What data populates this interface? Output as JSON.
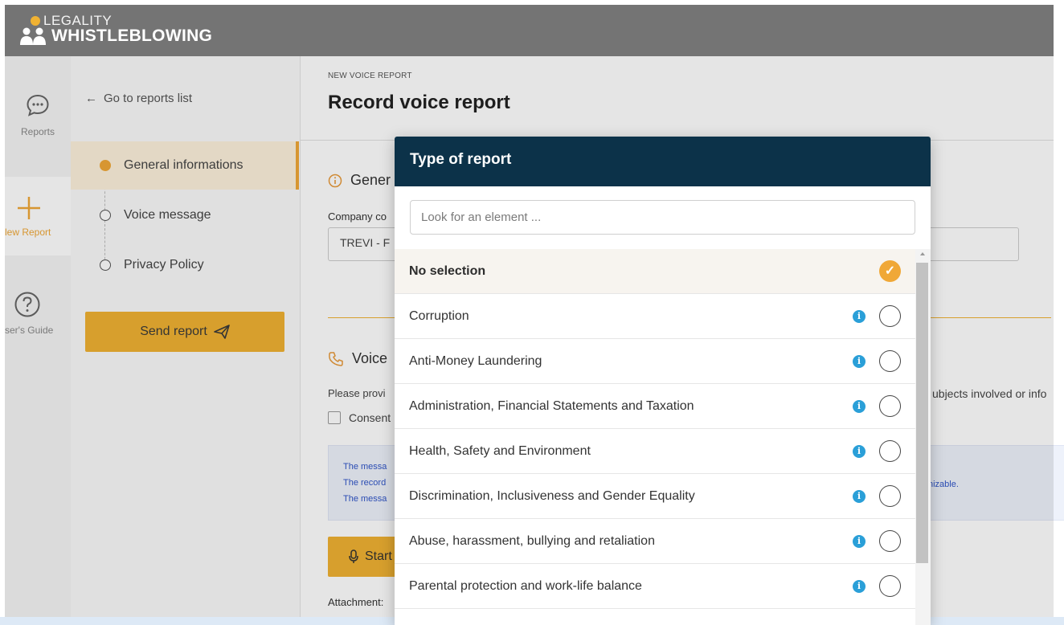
{
  "header": {
    "brand_top": "LEGALITY",
    "brand_bottom": "WHISTLEBLOWING"
  },
  "nav": {
    "reports_label": "Reports",
    "new_report_label": "lew Report",
    "guide_label": "ser's Guide"
  },
  "steps_panel": {
    "back_label": "Go to reports list",
    "steps": [
      {
        "label": "General informations",
        "active": true
      },
      {
        "label": "Voice message",
        "active": false
      },
      {
        "label": "Privacy Policy",
        "active": false
      }
    ],
    "send_label": "Send report"
  },
  "main": {
    "breadcrumb": "NEW VOICE REPORT",
    "title": "Record voice report",
    "section_general": "Gener",
    "company_label": "Company co",
    "company_value": "TREVI - F",
    "section_voice": "Voice",
    "help_text": "Please provi",
    "help_text_right": "ubjects involved or info",
    "consent_label": "Consent",
    "info_lines": [
      "The messa",
      "The record",
      "The messa"
    ],
    "info_right": "nizable.",
    "start_label": "Start",
    "attachments_label": "Attachment:"
  },
  "modal": {
    "title": "Type of report",
    "search_placeholder": "Look for an element ...",
    "options": [
      {
        "label": "No selection",
        "selected": true,
        "has_info": false
      },
      {
        "label": "Corruption",
        "selected": false,
        "has_info": true
      },
      {
        "label": "Anti-Money Laundering",
        "selected": false,
        "has_info": true
      },
      {
        "label": "Administration, Financial Statements and Taxation",
        "selected": false,
        "has_info": true
      },
      {
        "label": "Health, Safety and Environment",
        "selected": false,
        "has_info": true
      },
      {
        "label": "Discrimination, Inclusiveness and Gender Equality",
        "selected": false,
        "has_info": true
      },
      {
        "label": "Abuse, harassment, bullying and retaliation",
        "selected": false,
        "has_info": true
      },
      {
        "label": "Parental protection and work-life balance",
        "selected": false,
        "has_info": true
      }
    ]
  },
  "colors": {
    "header_bg": "#747474",
    "modal_header_bg": "#0c3249",
    "accent": "#f0b233",
    "info_icon": "#2a9fd8"
  }
}
